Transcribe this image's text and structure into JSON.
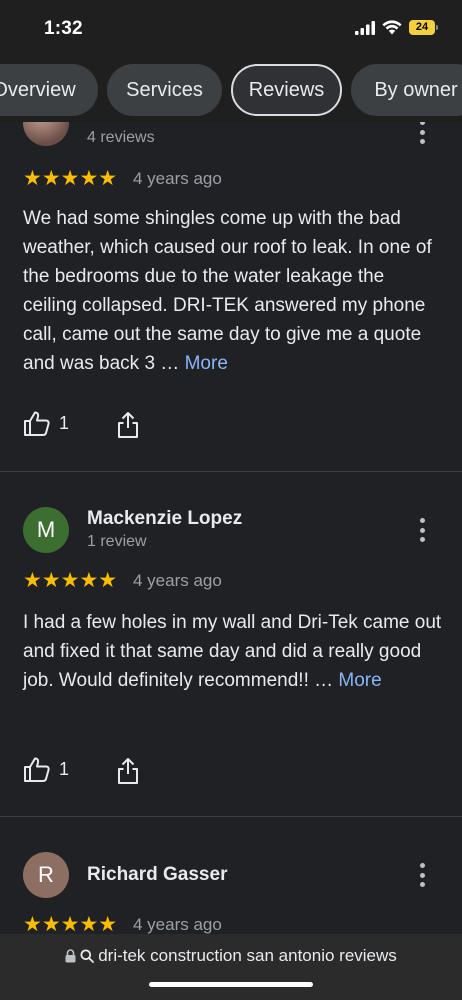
{
  "status_bar": {
    "time": "1:32",
    "battery": "24"
  },
  "tabs": [
    {
      "label": "Overview"
    },
    {
      "label": "Services"
    },
    {
      "label": "Reviews",
      "active": true
    },
    {
      "label": "By owner"
    }
  ],
  "reviews": [
    {
      "reviewer_count": "4 reviews",
      "stars": "★★★★★",
      "rating": 5,
      "date": "4 years ago",
      "text": "We had some shingles come up with the bad weather, which caused our roof to leak. In one of the bedrooms due to the water leakage the ceiling collapsed. DRI-TEK answered my phone call, came out the same day to give me a quote and was back 3 …",
      "more": "More",
      "likes": "1"
    },
    {
      "avatar_letter": "M",
      "avatar_color": "#3b6e2f",
      "reviewer_name": "Mackenzie Lopez",
      "reviewer_count": "1 review",
      "stars": "★★★★★",
      "rating": 5,
      "date": "4 years ago",
      "text": "I had a few holes in my wall and Dri-Tek came out and fixed it that same day and did a really good job. Would definitely recommend!! …",
      "more": "More",
      "likes": "1"
    },
    {
      "avatar_letter": "R",
      "avatar_color": "#8d6e63",
      "reviewer_name": "Richard Gasser",
      "stars": "★★★★★",
      "rating": 5,
      "date": "4 years ago"
    }
  ],
  "url_bar": {
    "text": "dri-tek construction san antonio reviews"
  },
  "colors": {
    "background": "#202124",
    "accent_link": "#8ab4f8",
    "star": "#fbbc04"
  }
}
